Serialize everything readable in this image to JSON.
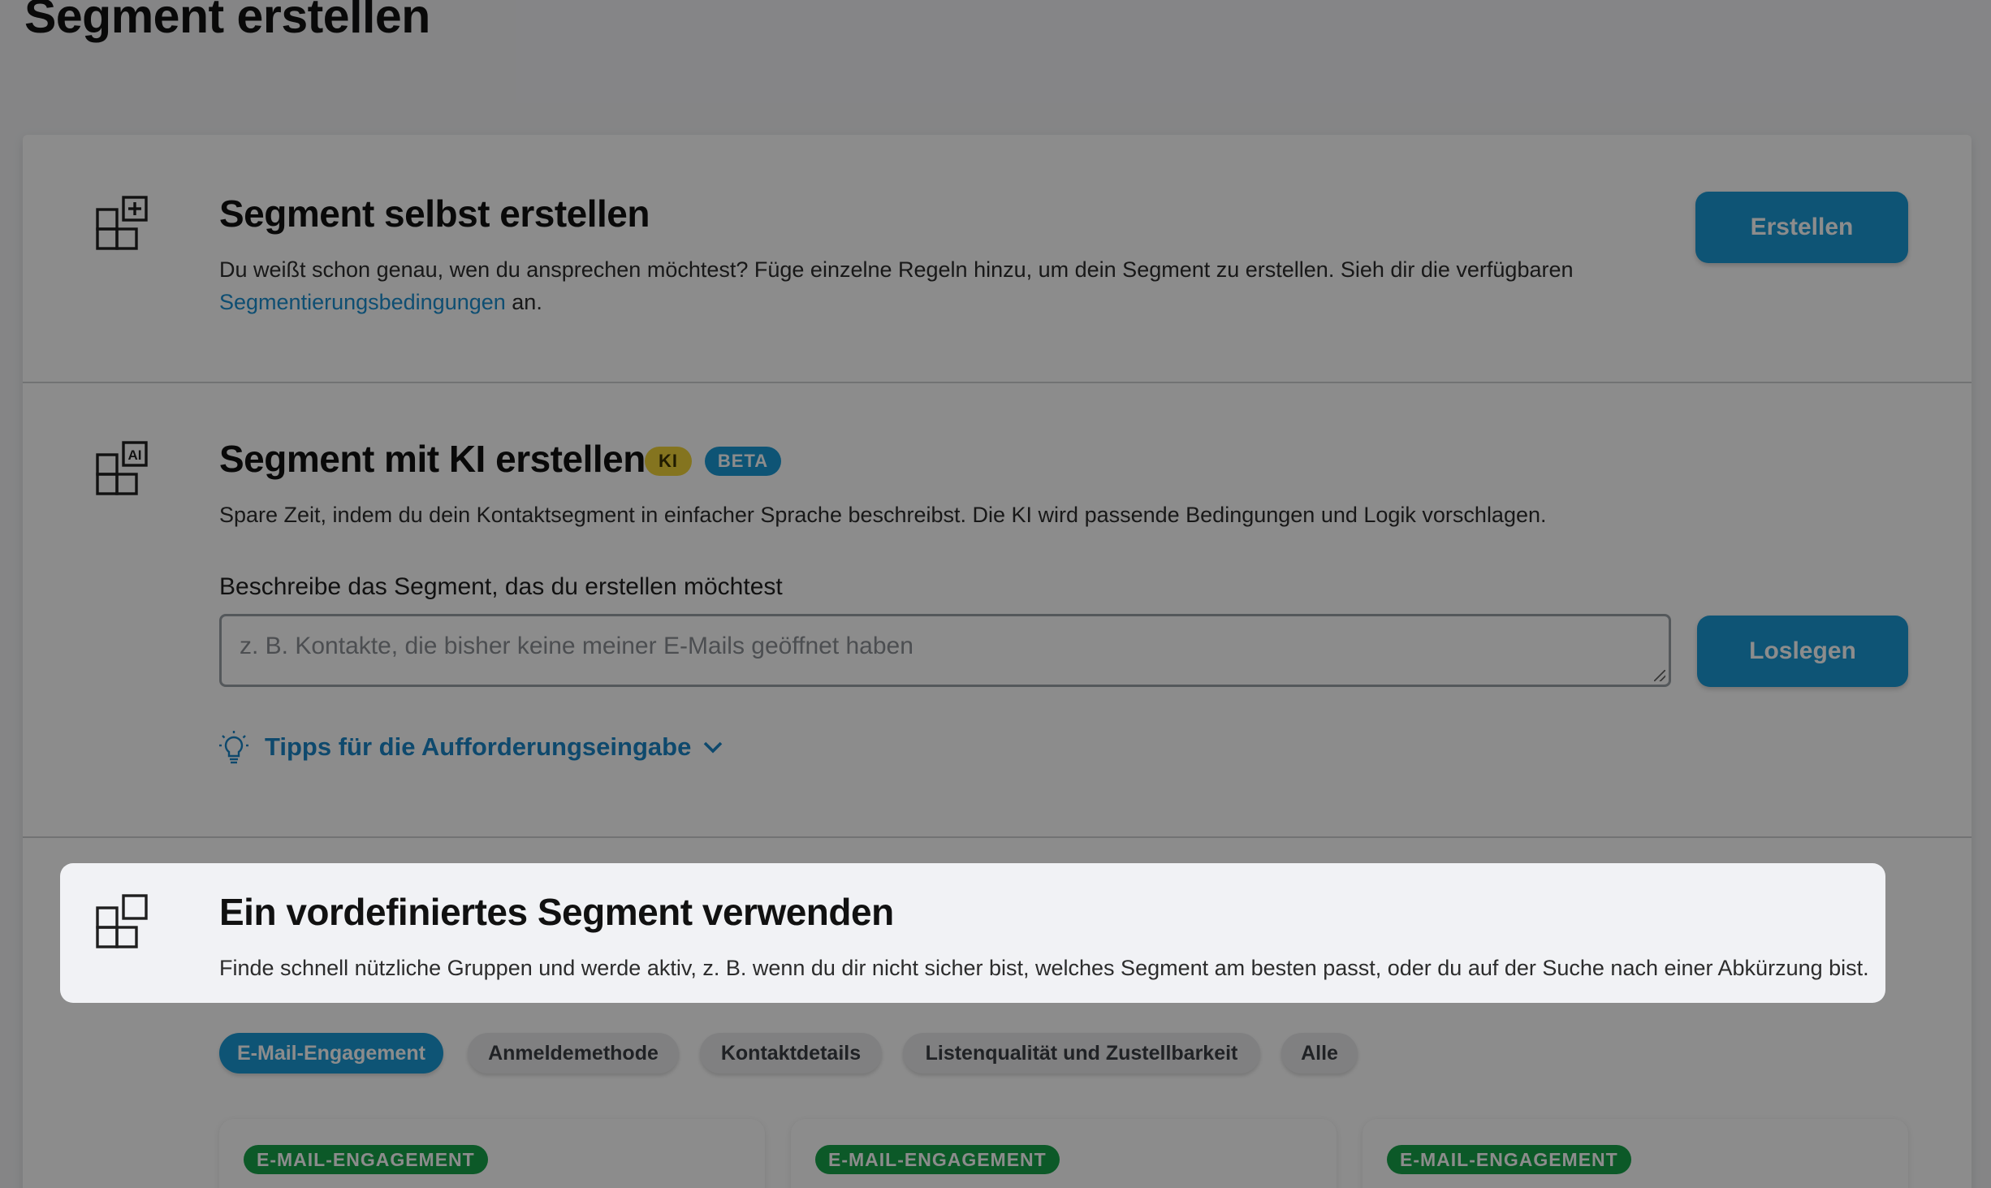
{
  "page": {
    "title": "Segment erstellen"
  },
  "section_manual": {
    "title": "Segment selbst erstellen",
    "desc_prefix": "Du weißt schon genau, wen du ansprechen möchtest? Füge einzelne Regeln hinzu, um dein Segment zu erstellen. Sieh dir die verfügbaren",
    "desc_link": "Segmentierungsbedingungen",
    "desc_suffix": " an.",
    "button_label": "Erstellen",
    "icon": "segment-add-icon"
  },
  "section_ai": {
    "title": "Segment mit KI erstellen",
    "badge_ki": "KI",
    "badge_beta": "BETA",
    "desc": "Spare Zeit, indem du dein Kontaktsegment in einfacher Sprache beschreibst. Die KI wird passende Bedingungen und Logik vorschlagen.",
    "field_label": "Beschreibe das Segment, das du erstellen möchtest",
    "field_placeholder": "z. B. Kontakte, die bisher keine meiner E-Mails geöffnet haben",
    "button_label": "Loslegen",
    "tips_label": "Tipps für die Aufforderungseingabe",
    "icon": "segment-ai-icon"
  },
  "section_predefined": {
    "title": "Ein vordefiniertes Segment verwenden",
    "desc": "Finde schnell nützliche Gruppen und werde aktiv, z. B. wenn du dir nicht sicher bist, welches Segment am besten passt, oder du auf der Suche nach einer Abkürzung bist.",
    "icon": "segment-predefined-icon"
  },
  "filters": [
    {
      "label": "E-Mail-Engagement",
      "active": true
    },
    {
      "label": "Anmeldemethode",
      "active": false
    },
    {
      "label": "Kontaktdetails",
      "active": false
    },
    {
      "label": "Listenqualität und Zustellbarkeit",
      "active": false
    },
    {
      "label": "Alle",
      "active": false
    }
  ],
  "cards": [
    {
      "tag": "E-MAIL-ENGAGEMENT"
    },
    {
      "tag": "E-MAIL-ENGAGEMENT"
    },
    {
      "tag": "E-MAIL-ENGAGEMENT"
    }
  ],
  "colors": {
    "primary": "#1a9ad6",
    "link": "#1a8fd0",
    "badge_ki": "#f0d33a",
    "tag_green": "#17a34a",
    "overlay": "rgba(0,0,0,0.45)"
  }
}
